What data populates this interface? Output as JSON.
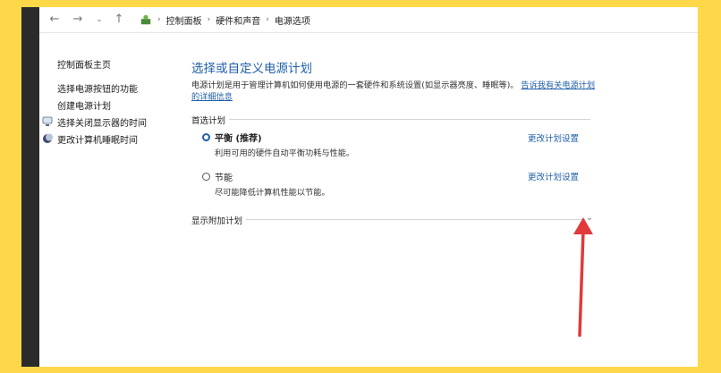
{
  "breadcrumbs": [
    "控制面板",
    "硬件和声音",
    "电源选项"
  ],
  "sidebar": {
    "home": "控制面板主页",
    "items": [
      {
        "label": "选择电源按钮的功能",
        "icon": ""
      },
      {
        "label": "创建电源计划",
        "icon": ""
      },
      {
        "label": "选择关闭显示器的时间",
        "icon": "monitor-icon"
      },
      {
        "label": "更改计算机睡眠时间",
        "icon": "moon-icon"
      }
    ]
  },
  "main": {
    "title": "选择或自定义电源计划",
    "description": "电源计划是用于管理计算机如何使用电源的一套硬件和系统设置(如显示器亮度、睡眠等)。",
    "description_link": "告诉我有关电源计划的详细信息",
    "preferred_label": "首选计划",
    "plans": [
      {
        "name": "平衡 (推荐)",
        "desc": "利用可用的硬件自动平衡功耗与性能。",
        "link": "更改计划设置",
        "selected": true
      },
      {
        "name": "节能",
        "desc": "尽可能降低计算机性能以节能。",
        "link": "更改计划设置",
        "selected": false
      }
    ],
    "additional_label": "显示附加计划"
  },
  "colors": {
    "background": "#ffd84a",
    "link": "#1f5fa8",
    "arrow": "#e03a3a"
  }
}
